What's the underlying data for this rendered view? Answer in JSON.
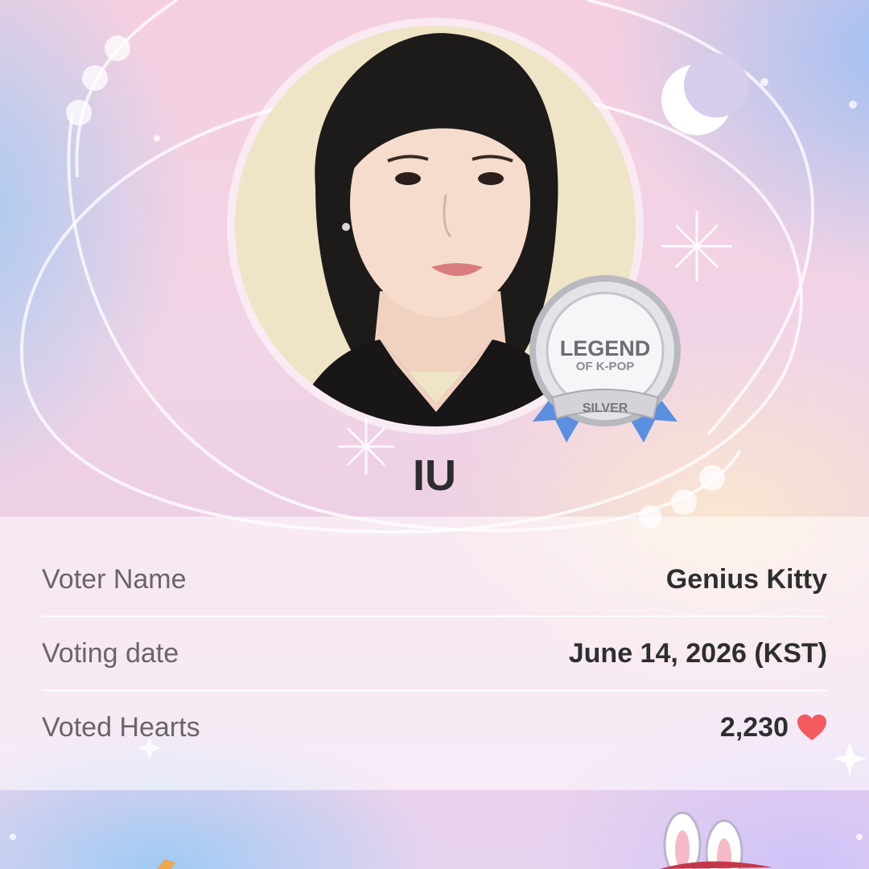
{
  "artist": {
    "name": "IU"
  },
  "badge": {
    "title": "LEGEND",
    "subtitle": "OF K-POP",
    "tier": "SILVER"
  },
  "vote_info": {
    "voter_name_label": "Voter Name",
    "voter_name_value": "Genius Kitty",
    "voting_date_label": "Voting date",
    "voting_date_value": "June 14, 2026 (KST)",
    "voted_hearts_label": "Voted Hearts",
    "voted_hearts_value": "2,230"
  },
  "icons": {
    "heart": "heart-icon",
    "moon": "crescent-moon-icon",
    "sparkle": "sparkle-icon"
  },
  "colors": {
    "heart": "#f25a5e",
    "ribbon": "#5b8fe0",
    "medal": "#c9c9cf"
  }
}
